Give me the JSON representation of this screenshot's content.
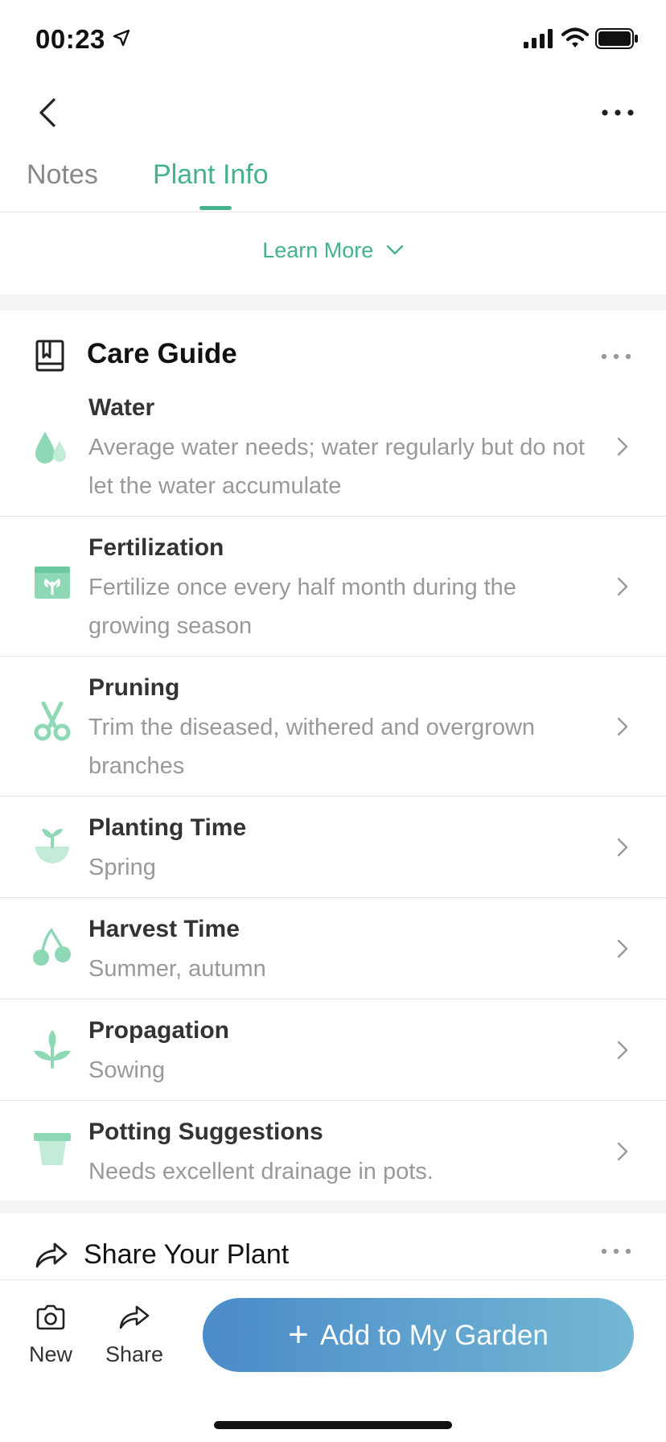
{
  "status_bar": {
    "time": "00:23"
  },
  "tabs": [
    {
      "label": "Notes"
    },
    {
      "label": "Plant Info"
    }
  ],
  "learn_more": {
    "label": "Learn More"
  },
  "care_guide": {
    "title": "Care Guide",
    "items": [
      {
        "title": "Water",
        "desc": "Average water needs; water regularly but do not let the water accumulate",
        "icon": "water-drops-icon"
      },
      {
        "title": "Fertilization",
        "desc": "Fertilize once every half month during the growing season",
        "icon": "fertilizer-bag-icon"
      },
      {
        "title": "Pruning",
        "desc": "Trim the diseased, withered and overgrown branches",
        "icon": "scissors-icon"
      },
      {
        "title": "Planting Time",
        "desc": "Spring",
        "icon": "sprout-pot-icon"
      },
      {
        "title": "Harvest Time",
        "desc": "Summer, autumn",
        "icon": "cherries-icon"
      },
      {
        "title": "Propagation",
        "desc": "Sowing",
        "icon": "seedling-icon"
      },
      {
        "title": "Potting Suggestions",
        "desc": "Needs excellent drainage in pots.",
        "icon": "flower-pot-icon"
      }
    ]
  },
  "share_plant": {
    "title": "Share Your Plant"
  },
  "bottom_bar": {
    "new_label": "New",
    "share_label": "Share",
    "add_label": "Add to My Garden"
  },
  "colors": {
    "accent_green": "#46b28d",
    "icon_green": "#8fd8b6",
    "button_gradient_start": "#4a8bc9",
    "button_gradient_end": "#73b8d4"
  }
}
